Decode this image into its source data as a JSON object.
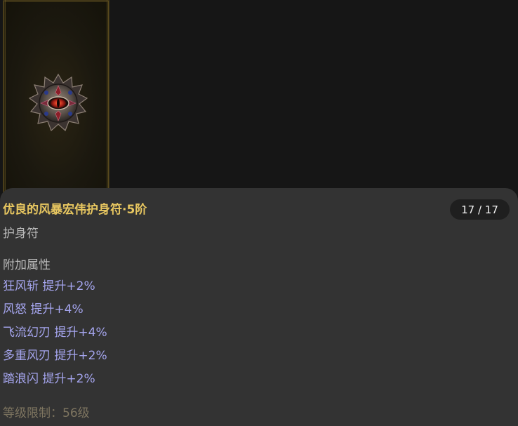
{
  "item": {
    "name": "优良的风暴宏伟护身符·5阶",
    "type": "护身符",
    "page_indicator": "17 / 17",
    "icon": "amulet-icon",
    "name_color": "#e8c760",
    "attribute_color": "#a5a5ee"
  },
  "attributes": {
    "header": "附加属性",
    "items": [
      {
        "text": "狂风斩 提升+2%"
      },
      {
        "text": "风怒 提升+4%"
      },
      {
        "text": "飞流幻刃 提升+4%"
      },
      {
        "text": "多重风刃 提升+2%"
      },
      {
        "text": "踏浪闪 提升+2%"
      }
    ]
  },
  "requirement": {
    "level_text": "等级限制：56级"
  }
}
